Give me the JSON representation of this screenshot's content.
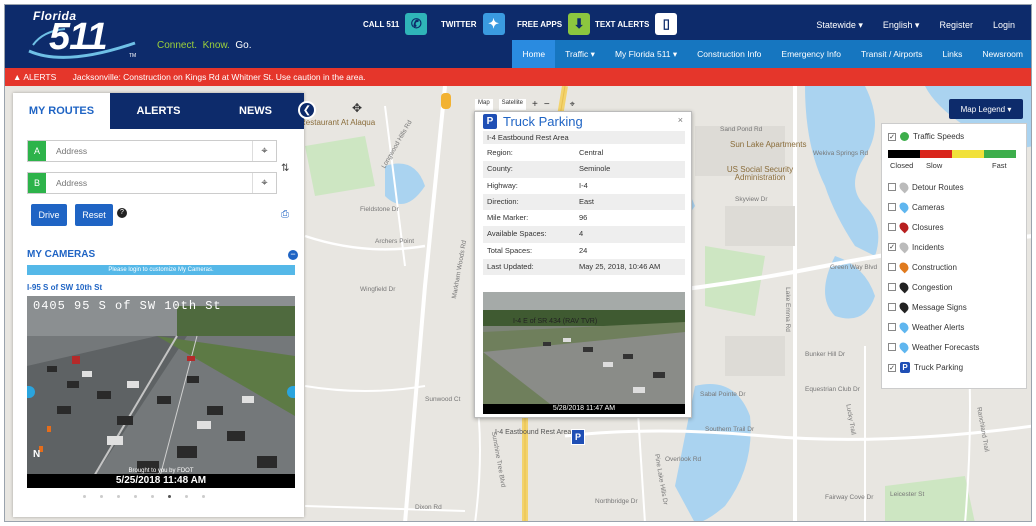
{
  "header": {
    "logo_top": "Florida",
    "logo_num": "511",
    "logo_tm": "TM",
    "tagline_connect": "Connect.",
    "tagline_know": "Know.",
    "tagline_go": "Go.",
    "features": {
      "call": "CALL 511",
      "twitter": "TWITTER",
      "apps": "FREE APPS",
      "alerts": "TEXT ALERTS"
    },
    "top_links": [
      "Statewide ▾",
      "English ▾",
      "Register",
      "Login"
    ],
    "nav": [
      "Home",
      "Traffic ▾",
      "My Florida 511 ▾",
      "Construction Info",
      "Emergency Info",
      "Transit / Airports",
      "Links",
      "Newsroom"
    ]
  },
  "alert_bar": {
    "label": "ALERTS",
    "message": "Jacksonville: Construction on Kings Rd at Whitner St. Use caution in the area."
  },
  "panel": {
    "tabs": [
      "MY ROUTES",
      "ALERTS",
      "NEWS"
    ],
    "address_a_label": "A",
    "address_b_label": "B",
    "address_placeholder": "Address",
    "drive": "Drive",
    "reset": "Reset",
    "help": "?",
    "my_cameras": "MY CAMERAS",
    "login_note": "Please login to customize My Cameras.",
    "camera_title": "I-95 S of SW 10th St",
    "camera_overlay": "0405 95 S of SW 10th St",
    "camera_credit": "Brought to you by FDOT",
    "camera_timestamp": "5/25/2018 11:48 AM",
    "camera_corner": "N"
  },
  "popup": {
    "title": "Truck Parking",
    "icon_letter": "P",
    "subtitle": "I-4 Eastbound Rest Area",
    "rows": [
      {
        "k": "Region:",
        "v": "Central"
      },
      {
        "k": "County:",
        "v": "Seminole"
      },
      {
        "k": "Highway:",
        "v": "I-4"
      },
      {
        "k": "Direction:",
        "v": "East"
      },
      {
        "k": "Mile Marker:",
        "v": "96"
      },
      {
        "k": "Available Spaces:",
        "v": "4"
      },
      {
        "k": "Total Spaces:",
        "v": "24"
      },
      {
        "k": "Last Updated:",
        "v": "May 25, 2018, 10:46 AM"
      }
    ],
    "cam_overlay": "I-4 E of SR 434 (RAV TVR)",
    "cam_timestamp": "5/28/2018 11:47 AM",
    "close": "×"
  },
  "map": {
    "controls": [
      "Map",
      "Satellite",
      "+",
      "−"
    ],
    "legend_button": "Map Legend ▾",
    "rest_area_label": "I-4 Eastbound Rest Area",
    "poi": [
      "Sun Lake Apartments",
      "US Social Security Administration",
      "Restaurant At Alaqua"
    ],
    "streets": [
      "Wekiva Springs Rd",
      "Markham Woods Rd",
      "Lake Emma Rd",
      "Archers Point",
      "Wingfield Dr",
      "Sunwood Ct",
      "Dixon Rd",
      "Overlook Rd",
      "Fairway Cove Dr",
      "Lucky Trail",
      "Ranchland Trail",
      "Bunker Hill Dr",
      "Green Way Blvd",
      "Equestrian Club Dr",
      "Pine Lake Hills Dr",
      "Northbridge Dr",
      "Skyview Dr",
      "Sand Pond Rd",
      "Sunshine Tree Blvd",
      "Longwood Hills Rd",
      "Fieldstone Dr",
      "Southern Trail Dr",
      "Sabal Pointe Dr",
      "Leicester St"
    ]
  },
  "legend": {
    "traffic_speeds": "Traffic Speeds",
    "closed": "Closed",
    "slow": "Slow",
    "fast": "Fast",
    "speed_colors": [
      "#000000",
      "#d9261c",
      "#f1e13a",
      "#3dae4b"
    ],
    "items": [
      {
        "label": "Detour Routes",
        "checked": false,
        "color": "#bbbbbb"
      },
      {
        "label": "Cameras",
        "checked": false,
        "color": "#5fb6ef"
      },
      {
        "label": "Closures",
        "checked": false,
        "color": "#b81f1f"
      },
      {
        "label": "Incidents",
        "checked": true,
        "color": "#bbbbbb"
      },
      {
        "label": "Construction",
        "checked": false,
        "color": "#e07a1e"
      },
      {
        "label": "Congestion",
        "checked": false,
        "color": "#222222"
      },
      {
        "label": "Message Signs",
        "checked": false,
        "color": "#222222"
      },
      {
        "label": "Weather Alerts",
        "checked": false,
        "color": "#5fb6ef"
      },
      {
        "label": "Weather Forecasts",
        "checked": false,
        "color": "#5fb6ef"
      },
      {
        "label": "Truck Parking",
        "checked": true,
        "color": "#1f4fb5"
      }
    ]
  }
}
